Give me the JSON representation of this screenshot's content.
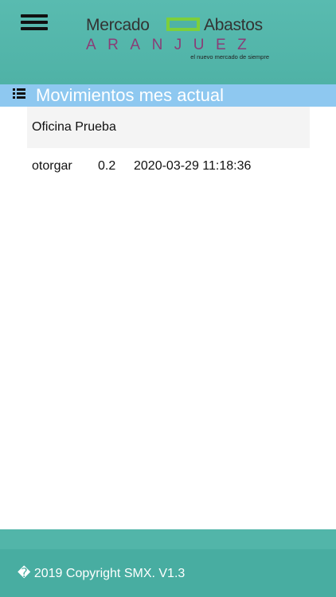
{
  "header": {
    "logo_word_left": "Mercado",
    "logo_word_right": "Abastos",
    "logo_city": "ARANJUEZ",
    "logo_tagline": "el nuevo mercado de siempre",
    "menu_icon": "hamburger-menu-icon"
  },
  "section": {
    "title": "Movimientos mes actual",
    "icon": "list-icon"
  },
  "account": {
    "name": "Oficina Prueba"
  },
  "movements": [
    {
      "type": "otorgar",
      "amount": "0.2",
      "datetime": "2020-03-29 11:18:36"
    }
  ],
  "footer": {
    "text": "� 2019 Copyright SMX. V1.3"
  },
  "colors": {
    "header_bg": "#4fb2a6",
    "section_bar": "#8ec8f0",
    "logo_box": "#7dcf3b",
    "logo_city": "#8a3d77"
  }
}
